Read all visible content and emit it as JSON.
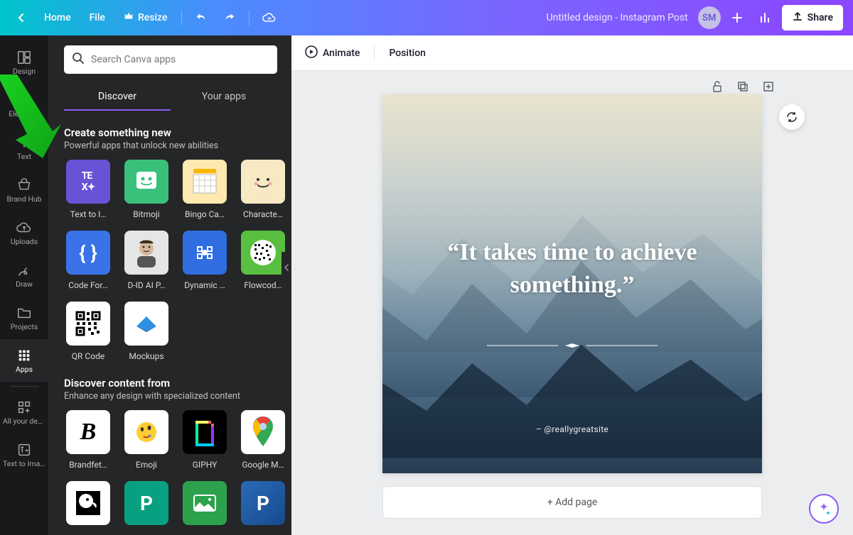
{
  "topbar": {
    "home": "Home",
    "file": "File",
    "resize": "Resize",
    "title": "Untitled design - Instagram Post",
    "avatar_initials": "SM",
    "share": "Share"
  },
  "rail": {
    "design": "Design",
    "elements": "Elements",
    "text": "Text",
    "brandhub": "Brand Hub",
    "uploads": "Uploads",
    "draw": "Draw",
    "projects": "Projects",
    "apps": "Apps",
    "allyourdesigns": "All your desi…",
    "texttoimage": "Text to Image"
  },
  "panel": {
    "search_placeholder": "Search Canva apps",
    "tab_discover": "Discover",
    "tab_yourapps": "Your apps",
    "section1_title": "Create something new",
    "section1_sub": "Powerful apps that unlock new abilities",
    "section2_title": "Discover content from",
    "section2_sub": "Enhance any design with specialized content",
    "apps1": [
      {
        "label": "Text to I…"
      },
      {
        "label": "Bitmoji"
      },
      {
        "label": "Bingo Ca…"
      },
      {
        "label": "Characte…"
      },
      {
        "label": "Code For…"
      },
      {
        "label": "D-ID AI P…"
      },
      {
        "label": "Dynamic …"
      },
      {
        "label": "Flowcod…"
      },
      {
        "label": "QR Code"
      },
      {
        "label": "Mockups"
      }
    ],
    "apps2": [
      {
        "label": "Brandfet…"
      },
      {
        "label": "Emoji"
      },
      {
        "label": "GIPHY"
      },
      {
        "label": "Google M…"
      }
    ]
  },
  "canvas": {
    "animate": "Animate",
    "position": "Position",
    "quote": "“It takes time to achieve something.”",
    "attribution": "– @reallygreatsite",
    "add_page": "+ Add page"
  }
}
